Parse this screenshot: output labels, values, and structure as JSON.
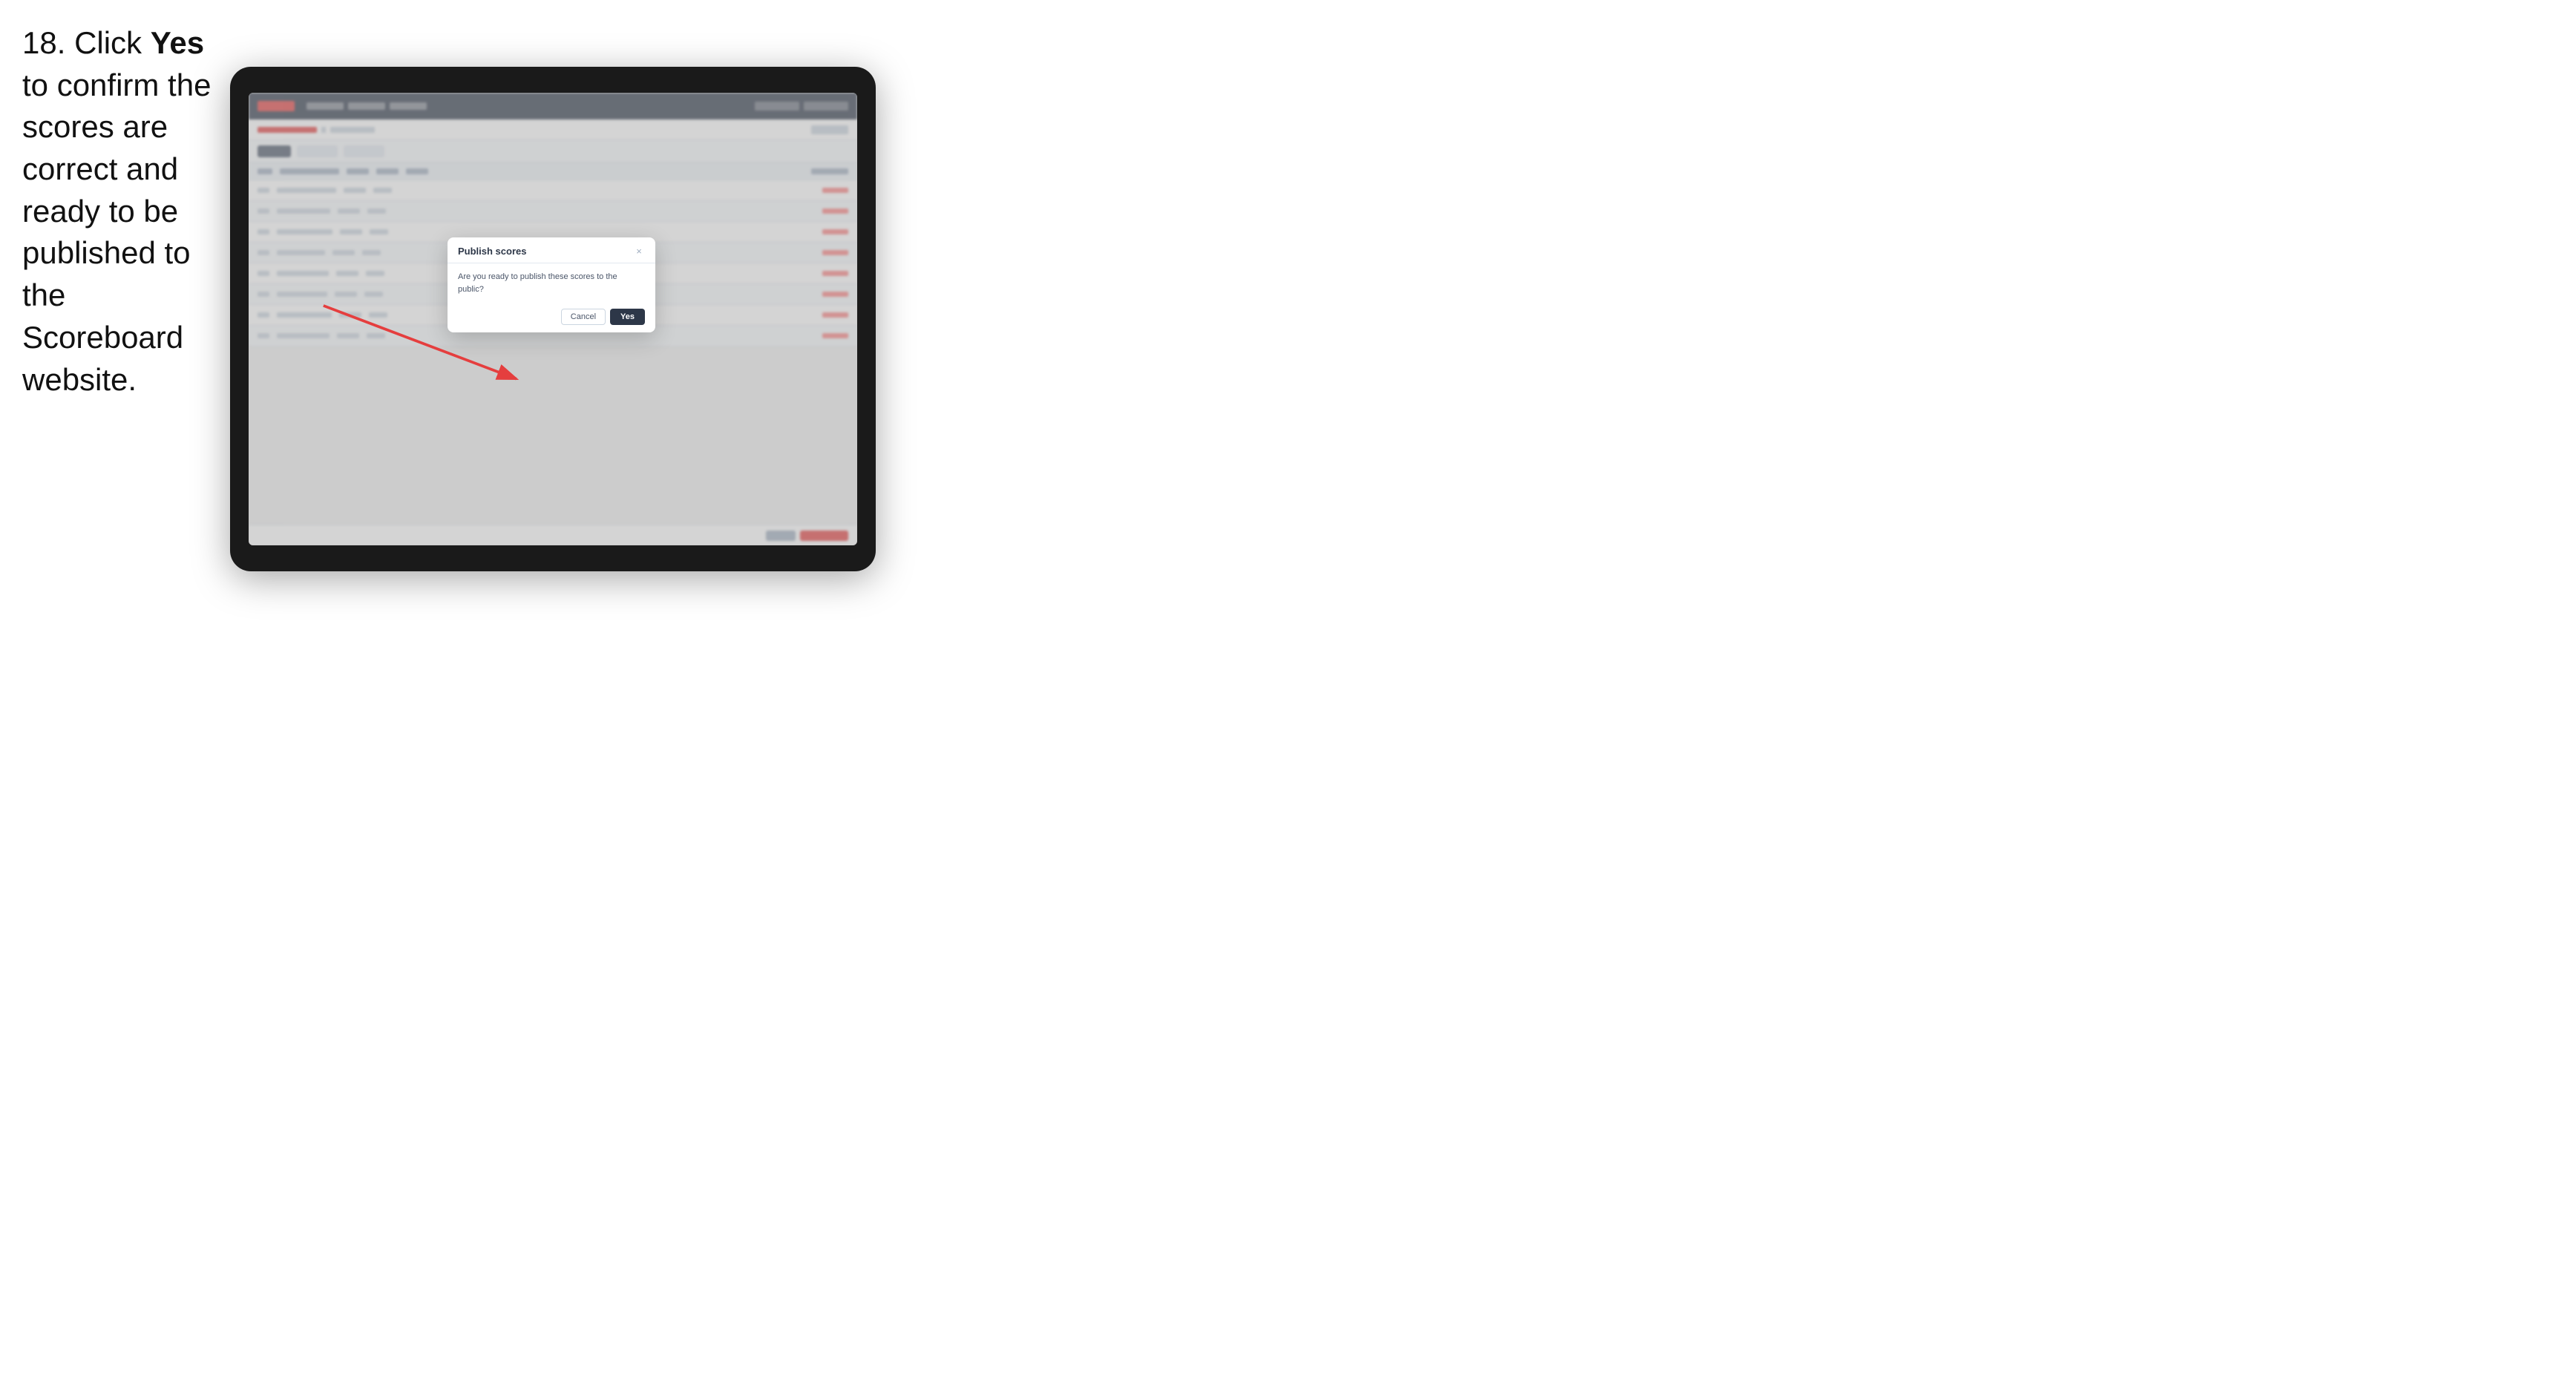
{
  "instruction": {
    "step_number": "18.",
    "text_part1": " Click ",
    "bold_text": "Yes",
    "text_part2": " to confirm the scores are correct and ready to be published to the Scoreboard website."
  },
  "tablet": {
    "background_color": "#1a1a1a"
  },
  "modal": {
    "title": "Publish scores",
    "message": "Are you ready to publish these scores to the public?",
    "cancel_label": "Cancel",
    "yes_label": "Yes",
    "close_icon": "×"
  },
  "bg_table": {
    "rows": [
      {
        "col1_width": 80,
        "col2_width": 30,
        "col3_width": 25,
        "col4_width": 30,
        "col5_width": 35
      },
      {
        "col1_width": 70,
        "col2_width": 30,
        "col3_width": 25,
        "col4_width": 30,
        "col5_width": 35
      },
      {
        "col1_width": 75,
        "col2_width": 30,
        "col3_width": 25,
        "col4_width": 30,
        "col5_width": 35
      },
      {
        "col1_width": 65,
        "col2_width": 30,
        "col3_width": 25,
        "col4_width": 30,
        "col5_width": 35
      },
      {
        "col1_width": 72,
        "col2_width": 30,
        "col3_width": 25,
        "col4_width": 30,
        "col5_width": 35
      },
      {
        "col1_width": 68,
        "col2_width": 30,
        "col3_width": 25,
        "col4_width": 30,
        "col5_width": 35
      },
      {
        "col1_width": 74,
        "col2_width": 30,
        "col3_width": 25,
        "col4_width": 30,
        "col5_width": 35
      },
      {
        "col1_width": 71,
        "col2_width": 30,
        "col3_width": 25,
        "col4_width": 30,
        "col5_width": 35
      }
    ]
  }
}
